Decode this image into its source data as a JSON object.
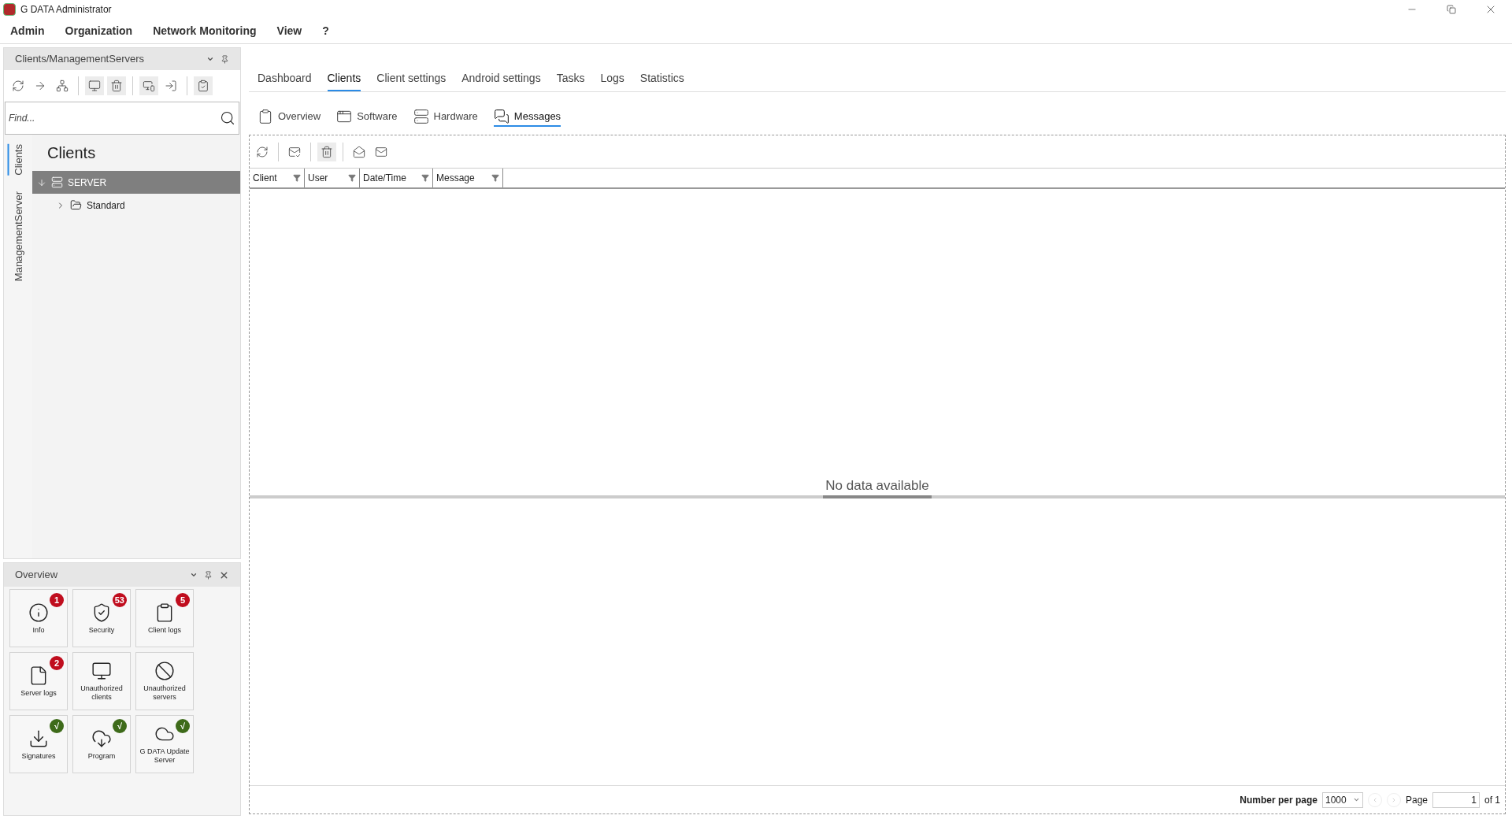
{
  "window": {
    "title": "G DATA Administrator"
  },
  "menu": [
    "Admin",
    "Organization",
    "Network Monitoring",
    "View",
    "?"
  ],
  "left_panel": {
    "title": "Clients/ManagementServers",
    "search": {
      "placeholder": "Find..."
    },
    "side_tabs": [
      {
        "label": "Clients",
        "selected": true
      },
      {
        "label": "ManagementServer",
        "selected": false
      }
    ],
    "heading": "Clients",
    "tree": [
      {
        "label": "SERVER",
        "kind": "server",
        "expanded": true,
        "selected": true,
        "children": [
          {
            "label": "Standard",
            "kind": "group",
            "expanded": false,
            "selected": false
          }
        ]
      }
    ]
  },
  "overview": {
    "title": "Overview",
    "tiles": [
      {
        "label": "Info",
        "kind": "info",
        "badge": "1",
        "color": "#c00d1e"
      },
      {
        "label": "Security",
        "kind": "shield",
        "badge": "53",
        "color": "#c00d1e"
      },
      {
        "label": "Client logs",
        "kind": "clipboard",
        "badge": "5",
        "color": "#c00d1e"
      },
      {
        "label": "Server logs",
        "kind": "file",
        "badge": "2",
        "color": "#c00d1e"
      },
      {
        "label": "Unauthorized clients",
        "kind": "monitor"
      },
      {
        "label": "Unauthorized servers",
        "kind": "ban"
      },
      {
        "label": "Signatures",
        "kind": "download",
        "badge": "√",
        "color": "#3e6b1a"
      },
      {
        "label": "Program",
        "kind": "cloud-download",
        "badge": "√",
        "color": "#3e6b1a"
      },
      {
        "label": "G DATA Update Server",
        "kind": "cloud",
        "badge": "√",
        "color": "#3e6b1a"
      }
    ]
  },
  "tabs": [
    {
      "label": "Dashboard",
      "selected": false
    },
    {
      "label": "Clients",
      "selected": true
    },
    {
      "label": "Client settings",
      "selected": false
    },
    {
      "label": "Android settings",
      "selected": false
    },
    {
      "label": "Tasks",
      "selected": false
    },
    {
      "label": "Logs",
      "selected": false
    },
    {
      "label": "Statistics",
      "selected": false
    }
  ],
  "subtabs": [
    {
      "label": "Overview",
      "kind": "clipboard",
      "selected": false
    },
    {
      "label": "Software",
      "kind": "window",
      "selected": false
    },
    {
      "label": "Hardware",
      "kind": "server",
      "selected": false
    },
    {
      "label": "Messages",
      "kind": "chat",
      "selected": true
    }
  ],
  "table": {
    "columns": [
      "Client",
      "User",
      "Date/Time",
      "Message"
    ],
    "empty_text": "No data available"
  },
  "pager": {
    "per_page_label": "Number per page",
    "per_page": "1000",
    "page_label": "Page",
    "page": "1",
    "page_count": "of 1"
  }
}
